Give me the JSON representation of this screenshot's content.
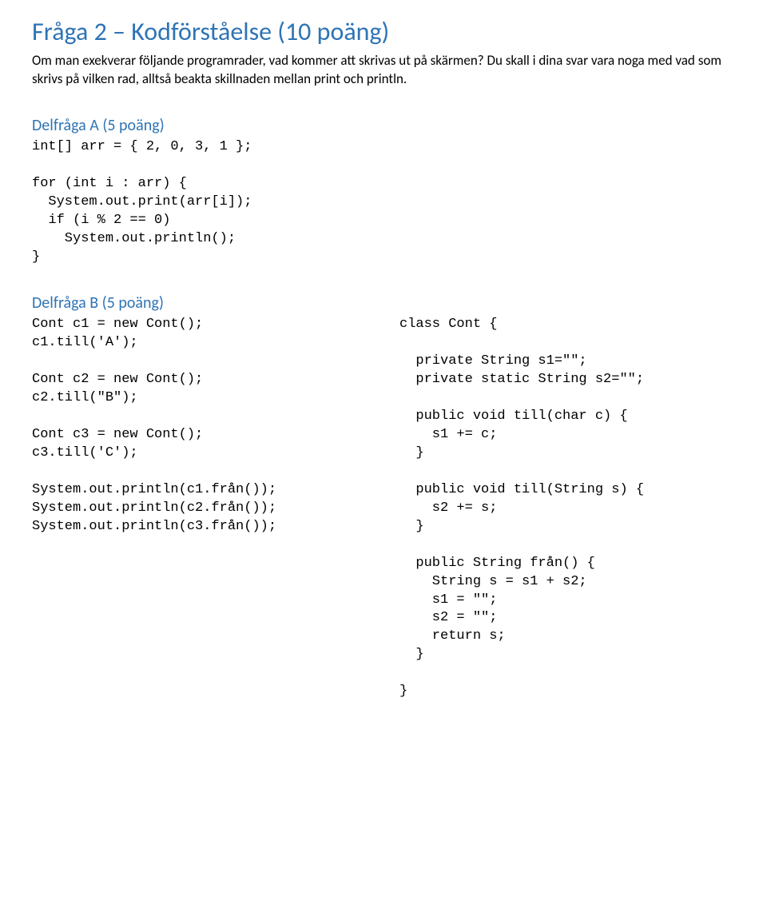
{
  "title": "Fråga 2 – Kodförståelse (10 poäng)",
  "intro": "Om man exekverar följande programrader, vad kommer att skrivas ut på skärmen? Du skall i dina svar vara noga med vad som skrivs på vilken rad, alltså beakta skillnaden mellan print och println.",
  "partA": {
    "heading": "Delfråga A (5 poäng)",
    "code": "int[] arr = { 2, 0, 3, 1 };\n\nfor (int i : arr) {\n  System.out.print(arr[i]);\n  if (i % 2 == 0)\n    System.out.println();\n}"
  },
  "partB": {
    "heading": "Delfråga B (5 poäng)",
    "leftCode": "Cont c1 = new Cont();\nc1.till('A');\n\nCont c2 = new Cont();\nc2.till(\"B\");\n\nCont c3 = new Cont();\nc3.till('C');\n\nSystem.out.println(c1.från());\nSystem.out.println(c2.från());\nSystem.out.println(c3.från());",
    "rightCode": "class Cont {\n\n  private String s1=\"\";\n  private static String s2=\"\";\n\n  public void till(char c) {\n    s1 += c;\n  }\n\n  public void till(String s) {\n    s2 += s;\n  }\n\n  public String från() {\n    String s = s1 + s2;\n    s1 = \"\";\n    s2 = \"\";\n    return s;\n  }\n\n}"
  }
}
